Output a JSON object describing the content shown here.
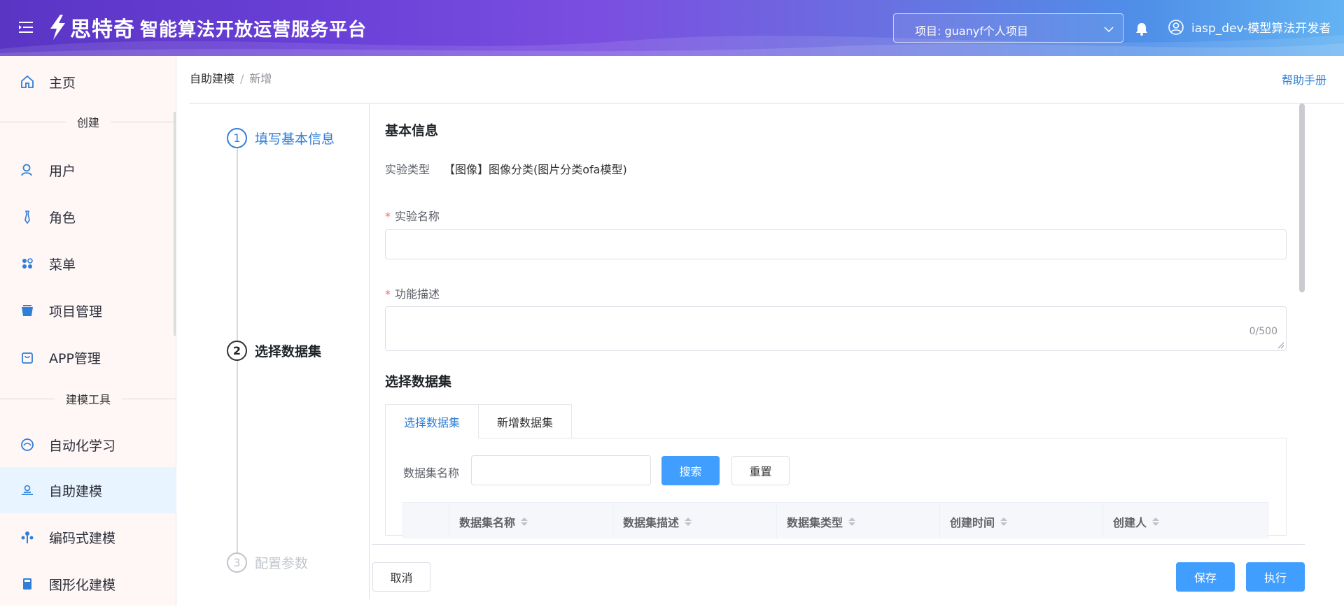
{
  "header": {
    "logo_text": "思特奇",
    "platform_title": "智能算法开放运营服务平台",
    "project_select": "项目: guanyf个人项目",
    "user": "iasp_dev-模型算法开发者"
  },
  "sidebar": {
    "home": "主页",
    "group_create": "创建",
    "items_create": [
      "用户",
      "角色",
      "菜单",
      "项目管理",
      "APP管理"
    ],
    "group_tools": "建模工具",
    "items_tools": [
      "自动化学习",
      "自助建模",
      "编码式建模",
      "图形化建模"
    ],
    "active": "自助建模"
  },
  "breadcrumb": {
    "root": "自助建模",
    "sep": "/",
    "current": "新增"
  },
  "help_link": "帮助手册",
  "steps": [
    {
      "num": "1",
      "label": "填写基本信息",
      "state": "active"
    },
    {
      "num": "2",
      "label": "选择数据集",
      "state": "current"
    },
    {
      "num": "3",
      "label": "配置参数",
      "state": "pending"
    }
  ],
  "basic": {
    "title": "基本信息",
    "type_label": "实验类型",
    "type_value": "【图像】图像分类(图片分类ofa模型)",
    "name_label": "实验名称",
    "desc_label": "功能描述",
    "desc_counter": "0/500",
    "required_mark": "*"
  },
  "dataset": {
    "title": "选择数据集",
    "tabs": [
      "选择数据集",
      "新增数据集"
    ],
    "search_label": "数据集名称",
    "search_button": "搜索",
    "reset_button": "重置",
    "columns": [
      "数据集名称",
      "数据集描述",
      "数据集类型",
      "创建时间",
      "创建人"
    ]
  },
  "footer": {
    "cancel": "取消",
    "save": "保存",
    "execute": "执行"
  },
  "colors": {
    "accent": "#409eff",
    "link": "#2f7fd8",
    "active_bg": "#e8f4ff",
    "required": "#f56c6c"
  }
}
